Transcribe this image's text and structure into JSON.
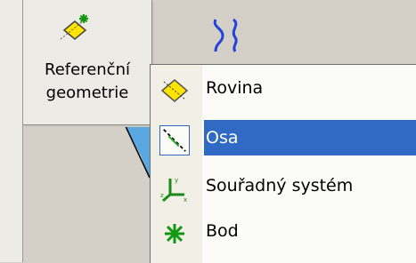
{
  "toolbar": {
    "reference_geometry_label_line1": "Referenční",
    "reference_geometry_label_line2": "geometrie"
  },
  "menu": {
    "items": [
      {
        "label": "Rovina",
        "icon": "plane-icon"
      },
      {
        "label": "Osa",
        "icon": "axis-icon",
        "selected": true
      },
      {
        "label": "Souřadný systém",
        "icon": "coordinate-system-icon"
      },
      {
        "label": "Bod",
        "icon": "point-icon"
      }
    ]
  },
  "colors": {
    "selection": "#316ac5",
    "menu_background": "#fbfbf7",
    "toolbar_background": "#ecebe6"
  }
}
